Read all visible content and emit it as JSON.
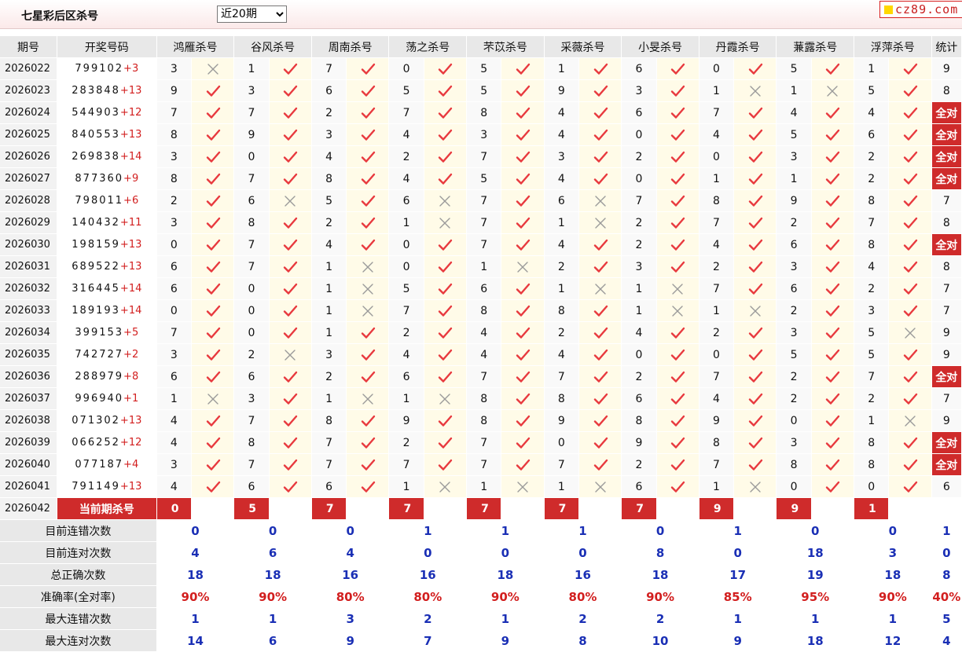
{
  "header": {
    "title": "七星彩后区杀号",
    "period_select": {
      "value": "近20期",
      "options": [
        "近20期"
      ]
    },
    "logo_text": "cz89.com"
  },
  "columns": {
    "period": "期号",
    "draw": "开奖号码",
    "killers": [
      "鸿雁杀号",
      "谷风杀号",
      "周南杀号",
      "荡之杀号",
      "芣苡杀号",
      "采薇杀号",
      "小旻杀号",
      "丹霞杀号",
      "蒹露杀号",
      "浮萍杀号"
    ],
    "stat": "统计"
  },
  "rows": [
    {
      "period": "2026022",
      "main": "799102",
      "extra": "+3",
      "kills": [
        [
          3,
          0
        ],
        [
          1,
          1
        ],
        [
          7,
          1
        ],
        [
          0,
          1
        ],
        [
          5,
          1
        ],
        [
          1,
          1
        ],
        [
          6,
          1
        ],
        [
          0,
          1
        ],
        [
          5,
          1
        ],
        [
          1,
          1
        ]
      ],
      "stat": "9"
    },
    {
      "period": "2026023",
      "main": "283848",
      "extra": "+13",
      "kills": [
        [
          9,
          1
        ],
        [
          3,
          1
        ],
        [
          6,
          1
        ],
        [
          5,
          1
        ],
        [
          5,
          1
        ],
        [
          9,
          1
        ],
        [
          3,
          1
        ],
        [
          1,
          0
        ],
        [
          1,
          0
        ],
        [
          5,
          1
        ]
      ],
      "stat": "8"
    },
    {
      "period": "2026024",
      "main": "544903",
      "extra": "+12",
      "kills": [
        [
          7,
          1
        ],
        [
          7,
          1
        ],
        [
          2,
          1
        ],
        [
          7,
          1
        ],
        [
          8,
          1
        ],
        [
          4,
          1
        ],
        [
          6,
          1
        ],
        [
          7,
          1
        ],
        [
          4,
          1
        ],
        [
          4,
          1
        ]
      ],
      "stat": "全对"
    },
    {
      "period": "2026025",
      "main": "840553",
      "extra": "+13",
      "kills": [
        [
          8,
          1
        ],
        [
          9,
          1
        ],
        [
          3,
          1
        ],
        [
          4,
          1
        ],
        [
          3,
          1
        ],
        [
          4,
          1
        ],
        [
          0,
          1
        ],
        [
          4,
          1
        ],
        [
          5,
          1
        ],
        [
          6,
          1
        ]
      ],
      "stat": "全对"
    },
    {
      "period": "2026026",
      "main": "269838",
      "extra": "+14",
      "kills": [
        [
          3,
          1
        ],
        [
          0,
          1
        ],
        [
          4,
          1
        ],
        [
          2,
          1
        ],
        [
          7,
          1
        ],
        [
          3,
          1
        ],
        [
          2,
          1
        ],
        [
          0,
          1
        ],
        [
          3,
          1
        ],
        [
          2,
          1
        ]
      ],
      "stat": "全对"
    },
    {
      "period": "2026027",
      "main": "877360",
      "extra": "+9",
      "kills": [
        [
          8,
          1
        ],
        [
          7,
          1
        ],
        [
          8,
          1
        ],
        [
          4,
          1
        ],
        [
          5,
          1
        ],
        [
          4,
          1
        ],
        [
          0,
          1
        ],
        [
          1,
          1
        ],
        [
          1,
          1
        ],
        [
          2,
          1
        ]
      ],
      "stat": "全对"
    },
    {
      "period": "2026028",
      "main": "798011",
      "extra": "+6",
      "kills": [
        [
          2,
          1
        ],
        [
          6,
          0
        ],
        [
          5,
          1
        ],
        [
          6,
          0
        ],
        [
          7,
          1
        ],
        [
          6,
          0
        ],
        [
          7,
          1
        ],
        [
          8,
          1
        ],
        [
          9,
          1
        ],
        [
          8,
          1
        ]
      ],
      "stat": "7"
    },
    {
      "period": "2026029",
      "main": "140432",
      "extra": "+11",
      "kills": [
        [
          3,
          1
        ],
        [
          8,
          1
        ],
        [
          2,
          1
        ],
        [
          1,
          0
        ],
        [
          7,
          1
        ],
        [
          1,
          0
        ],
        [
          2,
          1
        ],
        [
          7,
          1
        ],
        [
          2,
          1
        ],
        [
          7,
          1
        ]
      ],
      "stat": "8"
    },
    {
      "period": "2026030",
      "main": "198159",
      "extra": "+13",
      "kills": [
        [
          0,
          1
        ],
        [
          7,
          1
        ],
        [
          4,
          1
        ],
        [
          0,
          1
        ],
        [
          7,
          1
        ],
        [
          4,
          1
        ],
        [
          2,
          1
        ],
        [
          4,
          1
        ],
        [
          6,
          1
        ],
        [
          8,
          1
        ]
      ],
      "stat": "全对"
    },
    {
      "period": "2026031",
      "main": "689522",
      "extra": "+13",
      "kills": [
        [
          6,
          1
        ],
        [
          7,
          1
        ],
        [
          1,
          0
        ],
        [
          0,
          1
        ],
        [
          1,
          0
        ],
        [
          2,
          1
        ],
        [
          3,
          1
        ],
        [
          2,
          1
        ],
        [
          3,
          1
        ],
        [
          4,
          1
        ]
      ],
      "stat": "8"
    },
    {
      "period": "2026032",
      "main": "316445",
      "extra": "+14",
      "kills": [
        [
          6,
          1
        ],
        [
          0,
          1
        ],
        [
          1,
          0
        ],
        [
          5,
          1
        ],
        [
          6,
          1
        ],
        [
          1,
          0
        ],
        [
          1,
          0
        ],
        [
          7,
          1
        ],
        [
          6,
          1
        ],
        [
          2,
          1
        ]
      ],
      "stat": "7"
    },
    {
      "period": "2026033",
      "main": "189193",
      "extra": "+14",
      "kills": [
        [
          0,
          1
        ],
        [
          0,
          1
        ],
        [
          1,
          0
        ],
        [
          7,
          1
        ],
        [
          8,
          1
        ],
        [
          8,
          1
        ],
        [
          1,
          0
        ],
        [
          1,
          0
        ],
        [
          2,
          1
        ],
        [
          3,
          1
        ]
      ],
      "stat": "7"
    },
    {
      "period": "2026034",
      "main": "399153",
      "extra": "+5",
      "kills": [
        [
          7,
          1
        ],
        [
          0,
          1
        ],
        [
          1,
          1
        ],
        [
          2,
          1
        ],
        [
          4,
          1
        ],
        [
          2,
          1
        ],
        [
          4,
          1
        ],
        [
          2,
          1
        ],
        [
          3,
          1
        ],
        [
          5,
          0
        ]
      ],
      "stat": "9"
    },
    {
      "period": "2026035",
      "main": "742727",
      "extra": "+2",
      "kills": [
        [
          3,
          1
        ],
        [
          2,
          0
        ],
        [
          3,
          1
        ],
        [
          4,
          1
        ],
        [
          4,
          1
        ],
        [
          4,
          1
        ],
        [
          0,
          1
        ],
        [
          0,
          1
        ],
        [
          5,
          1
        ],
        [
          5,
          1
        ]
      ],
      "stat": "9"
    },
    {
      "period": "2026036",
      "main": "288979",
      "extra": "+8",
      "kills": [
        [
          6,
          1
        ],
        [
          6,
          1
        ],
        [
          2,
          1
        ],
        [
          6,
          1
        ],
        [
          7,
          1
        ],
        [
          7,
          1
        ],
        [
          2,
          1
        ],
        [
          7,
          1
        ],
        [
          2,
          1
        ],
        [
          7,
          1
        ]
      ],
      "stat": "全对"
    },
    {
      "period": "2026037",
      "main": "996940",
      "extra": "+1",
      "kills": [
        [
          1,
          0
        ],
        [
          3,
          1
        ],
        [
          1,
          0
        ],
        [
          1,
          0
        ],
        [
          8,
          1
        ],
        [
          8,
          1
        ],
        [
          6,
          1
        ],
        [
          4,
          1
        ],
        [
          2,
          1
        ],
        [
          2,
          1
        ]
      ],
      "stat": "7"
    },
    {
      "period": "2026038",
      "main": "071302",
      "extra": "+13",
      "kills": [
        [
          4,
          1
        ],
        [
          7,
          1
        ],
        [
          8,
          1
        ],
        [
          9,
          1
        ],
        [
          8,
          1
        ],
        [
          9,
          1
        ],
        [
          8,
          1
        ],
        [
          9,
          1
        ],
        [
          0,
          1
        ],
        [
          1,
          0
        ]
      ],
      "stat": "9"
    },
    {
      "period": "2026039",
      "main": "066252",
      "extra": "+12",
      "kills": [
        [
          4,
          1
        ],
        [
          8,
          1
        ],
        [
          7,
          1
        ],
        [
          2,
          1
        ],
        [
          7,
          1
        ],
        [
          0,
          1
        ],
        [
          9,
          1
        ],
        [
          8,
          1
        ],
        [
          3,
          1
        ],
        [
          8,
          1
        ]
      ],
      "stat": "全对"
    },
    {
      "period": "2026040",
      "main": "077187",
      "extra": "+4",
      "kills": [
        [
          3,
          1
        ],
        [
          7,
          1
        ],
        [
          7,
          1
        ],
        [
          7,
          1
        ],
        [
          7,
          1
        ],
        [
          7,
          1
        ],
        [
          2,
          1
        ],
        [
          7,
          1
        ],
        [
          8,
          1
        ],
        [
          8,
          1
        ]
      ],
      "stat": "全对"
    },
    {
      "period": "2026041",
      "main": "791149",
      "extra": "+13",
      "kills": [
        [
          4,
          1
        ],
        [
          6,
          1
        ],
        [
          6,
          1
        ],
        [
          1,
          0
        ],
        [
          1,
          0
        ],
        [
          1,
          0
        ],
        [
          6,
          1
        ],
        [
          1,
          0
        ],
        [
          0,
          1
        ],
        [
          0,
          1
        ]
      ],
      "stat": "6"
    }
  ],
  "current": {
    "period": "2026042",
    "label": "当前期杀号",
    "kills": [
      "0",
      "5",
      "7",
      "7",
      "7",
      "7",
      "7",
      "9",
      "9",
      "1"
    ]
  },
  "summary": [
    {
      "label": "目前连错次数",
      "values": [
        "0",
        "0",
        "0",
        "1",
        "1",
        "1",
        "0",
        "1",
        "0",
        "0",
        "1"
      ]
    },
    {
      "label": "目前连对次数",
      "values": [
        "4",
        "6",
        "4",
        "0",
        "0",
        "0",
        "8",
        "0",
        "18",
        "3",
        "0"
      ]
    },
    {
      "label": "总正确次数",
      "values": [
        "18",
        "18",
        "16",
        "16",
        "18",
        "16",
        "18",
        "17",
        "19",
        "18",
        "8"
      ]
    },
    {
      "label": "准确率(全对率)",
      "values": [
        "90%",
        "90%",
        "80%",
        "80%",
        "90%",
        "80%",
        "90%",
        "85%",
        "95%",
        "90%",
        "40%"
      ],
      "red": true
    },
    {
      "label": "最大连错次数",
      "values": [
        "1",
        "1",
        "3",
        "2",
        "1",
        "2",
        "2",
        "1",
        "1",
        "1",
        "5"
      ]
    },
    {
      "label": "最大连对次数",
      "values": [
        "14",
        "6",
        "9",
        "7",
        "9",
        "8",
        "10",
        "9",
        "18",
        "12",
        "4"
      ]
    }
  ],
  "marks": {
    "correct_icon": "check-icon",
    "wrong_icon": "cross-icon",
    "correct_color": "#e8393e",
    "allright_bg": "#cf2b2b"
  }
}
